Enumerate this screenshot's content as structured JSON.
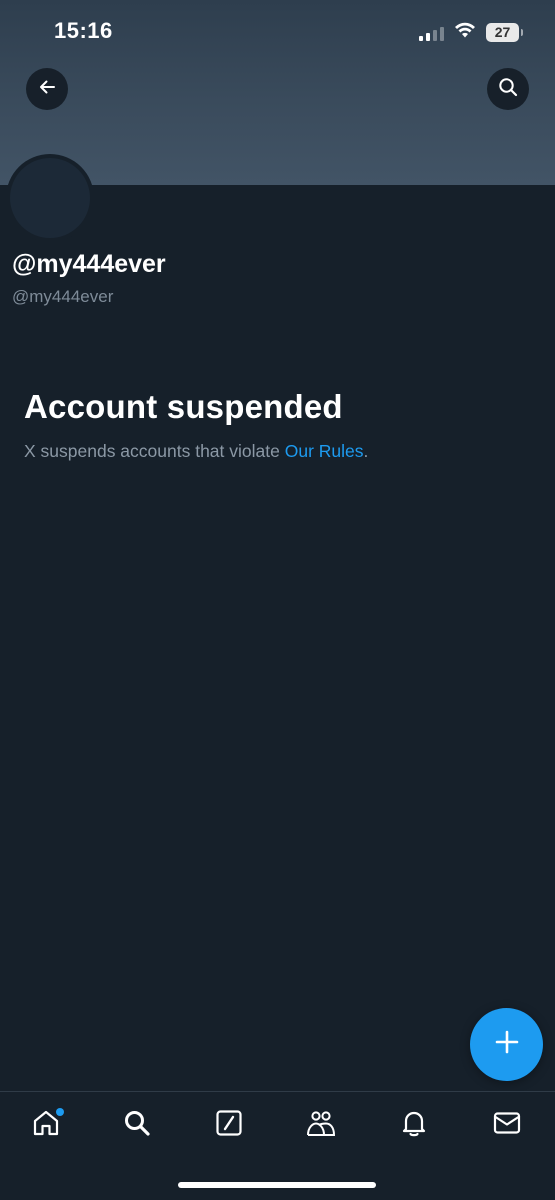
{
  "status_bar": {
    "time": "15:16",
    "battery": "27"
  },
  "header": {
    "back_icon": "arrow-left-icon",
    "search_icon": "search-icon"
  },
  "profile": {
    "display_name": "@my444ever",
    "handle": "@my444ever"
  },
  "suspension": {
    "title": "Account suspended",
    "message": "X suspends accounts that violate ",
    "link_text": "Our Rules",
    "message_end": "."
  },
  "fab": {
    "icon": "plus-icon"
  },
  "bottom_nav": {
    "items": [
      {
        "icon": "home-icon",
        "has_notification_dot": true
      },
      {
        "icon": "search-icon"
      },
      {
        "icon": "grok-icon"
      },
      {
        "icon": "communities-icon"
      },
      {
        "icon": "bell-icon"
      },
      {
        "icon": "mail-icon"
      }
    ]
  },
  "colors": {
    "background": "#16202a",
    "accent": "#1d9bf0",
    "secondary_text": "#8b98a5"
  }
}
